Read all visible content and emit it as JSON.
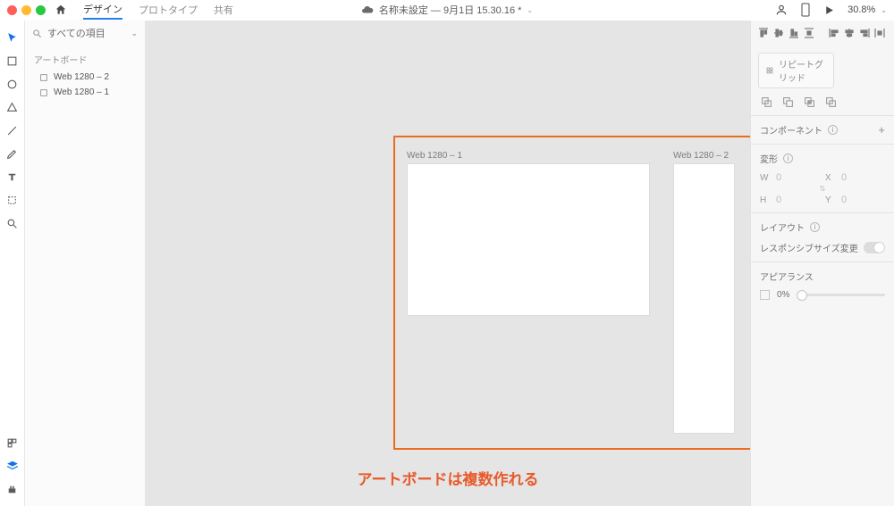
{
  "header": {
    "tabs": {
      "design": "デザイン",
      "prototype": "プロトタイプ",
      "share": "共有"
    },
    "title": "名称未設定 — 9月1日 15.30.16 *",
    "zoom": "30.8%"
  },
  "leftpanel": {
    "search_label": "すべての項目",
    "section_label": "アートボード",
    "items": [
      {
        "label": "Web 1280 – 2"
      },
      {
        "label": "Web 1280 – 1"
      }
    ]
  },
  "canvas": {
    "artboards": [
      {
        "label": "Web 1280 – 1"
      },
      {
        "label": "Web 1280 – 2"
      }
    ],
    "caption": "アートボードは複数作れる"
  },
  "rightpanel": {
    "repeat_grid": "リピートグリッド",
    "component": "コンポーネント",
    "transform": "変形",
    "fields": {
      "w": "W",
      "h": "H",
      "x": "X",
      "y": "Y",
      "zero": "0"
    },
    "layout": "レイアウト",
    "responsive": "レスポンシブサイズ変更",
    "appearance": "アピアランス",
    "opacity": "0%"
  },
  "icons": {
    "home": "home-icon",
    "cloud": "cloud-icon",
    "user": "user-icon",
    "device": "device-preview-icon",
    "play": "play-icon"
  }
}
